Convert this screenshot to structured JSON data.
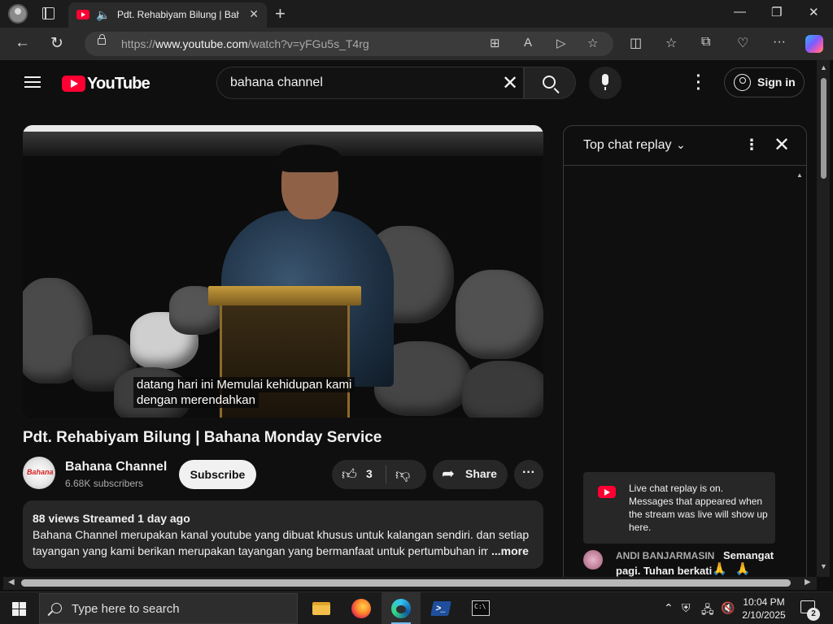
{
  "browser": {
    "tab_title": "Pdt. Rehabiyam Bilung | Bahana Monday Service",
    "url_prefix": "https://",
    "url_host": "www.youtube.com",
    "url_path": "/watch?v=yFGu5s_T4rg"
  },
  "youtube": {
    "logo_text": "YouTube",
    "search_value": "bahana channel",
    "signin_label": "Sign in",
    "video": {
      "caption_line1": "datang hari ini Memulai kehidupan kami",
      "caption_line2": "dengan merendahkan"
    },
    "title": "Pdt. Rehabiyam Bilung | Bahana Monday Service",
    "channel": {
      "name": "Bahana Channel",
      "subscribers": "6.68K subscribers",
      "avatar_text": "Bahana"
    },
    "subscribe_label": "Subscribe",
    "like_count": "3",
    "share_label": "Share",
    "description": {
      "meta": "88 views  Streamed 1 day ago",
      "line1": "Bahana Channel merupakan kanal youtube yang dibuat khusus untuk kalangan sendiri. dan setiap",
      "line2": "tayangan yang kami berikan merupakan tayangan yang bermanfaat untuk pertumbuhan im",
      "more_label": "...more"
    },
    "chat": {
      "title": "Top chat replay",
      "notice": "Live chat replay is on. Messages that appeared when the stream was live will show up here.",
      "message": {
        "author": "ANDI BANJARMASIN",
        "text_part1": "Semangat",
        "text_part2": "pagi. Tuhan berkati",
        "emoji": "🙏🙏"
      }
    }
  },
  "taskbar": {
    "search_placeholder": "Type here to search",
    "time": "10:04 PM",
    "date": "2/10/2025",
    "notification_count": "2"
  },
  "colors": {
    "youtube_red": "#ff0033",
    "page_bg": "#0f0f0f",
    "chip_bg": "#272727"
  }
}
